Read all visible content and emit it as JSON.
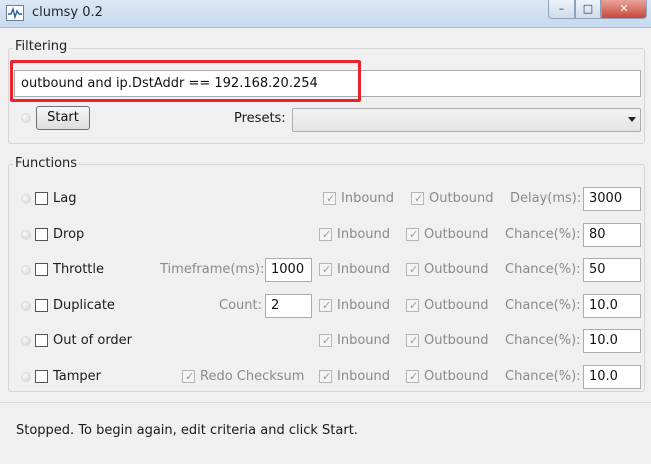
{
  "window": {
    "title": "clumsy 0.2",
    "min_glyph": "–",
    "max_glyph": "□",
    "close_glyph": "✕"
  },
  "filtering": {
    "legend": "Filtering",
    "filter_value": "outbound and ip.DstAddr == 192.168.20.254",
    "start_label": "Start",
    "presets_label": "Presets:",
    "presets_selected": ""
  },
  "functions": {
    "legend": "Functions",
    "inbound_label": "Inbound",
    "outbound_label": "Outbound",
    "rows": [
      {
        "name": "Lag",
        "param_label": "Delay(ms):",
        "param_value": "3000"
      },
      {
        "name": "Drop",
        "param_label": "Chance(%):",
        "param_value": "80"
      },
      {
        "name": "Throttle",
        "extra_label": "Timeframe(ms):",
        "extra_value": "1000",
        "param_label": "Chance(%):",
        "param_value": "50"
      },
      {
        "name": "Duplicate",
        "extra_label": "Count:",
        "extra_value": "2",
        "param_label": "Chance(%):",
        "param_value": "10.0"
      },
      {
        "name": "Out of order",
        "param_label": "Chance(%):",
        "param_value": "10.0"
      },
      {
        "name": "Tamper",
        "extra_label": "Redo Checksum",
        "param_label": "Chance(%):",
        "param_value": "10.0"
      }
    ]
  },
  "status": {
    "text": "Stopped. To begin again, edit criteria and click Start."
  }
}
